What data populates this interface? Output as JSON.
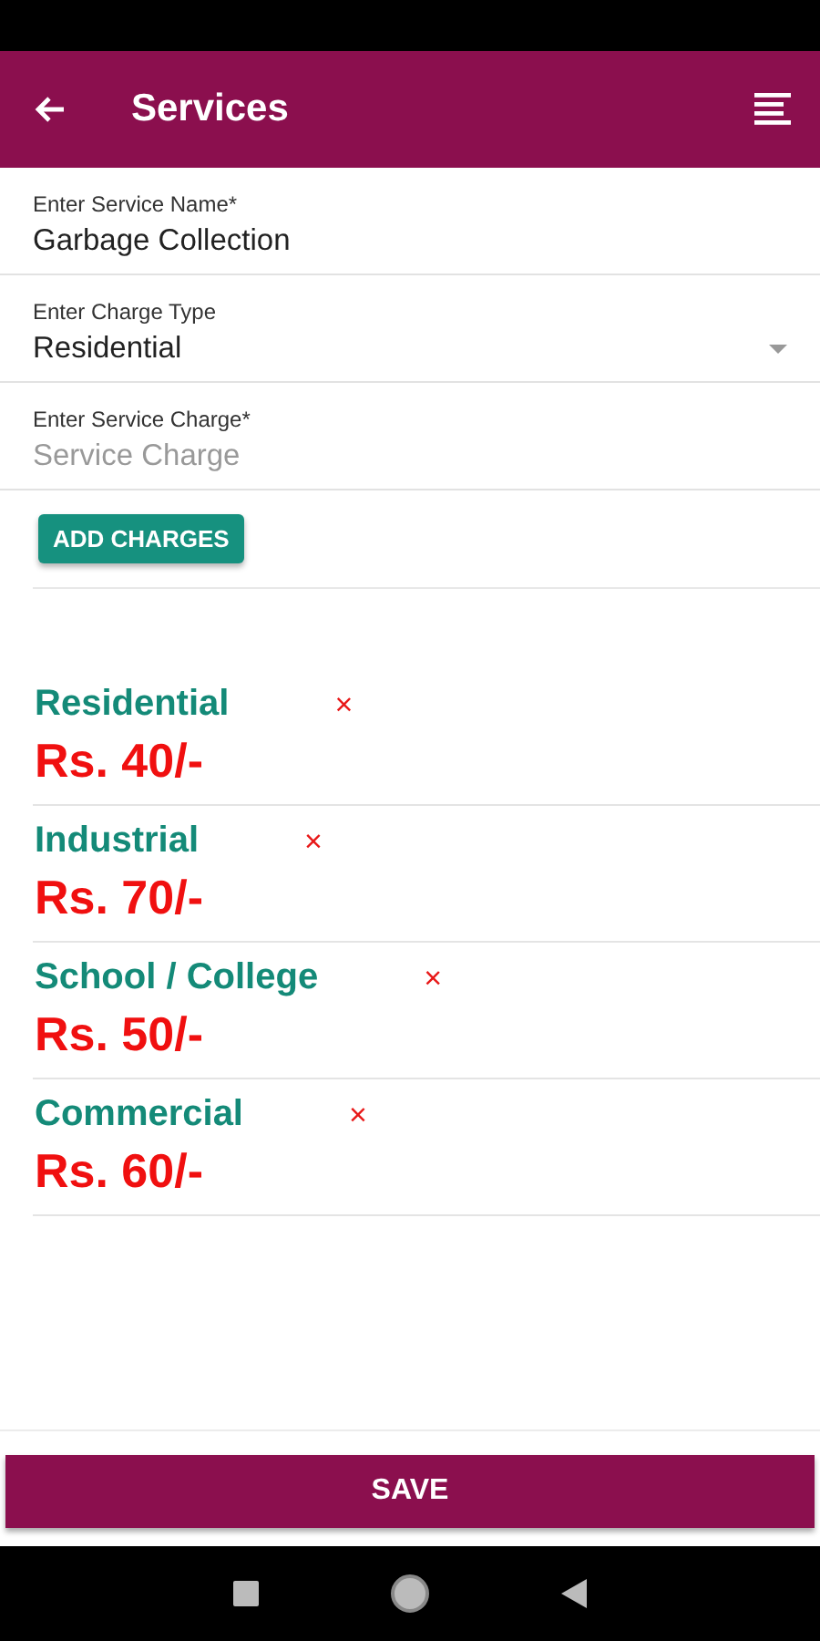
{
  "header": {
    "title": "Services"
  },
  "fields": [
    {
      "kind": "text",
      "label": "Enter Service Name*",
      "value": "Garbage Collection"
    },
    {
      "kind": "select",
      "label": "Enter Charge Type",
      "value": "Residential"
    },
    {
      "kind": "text",
      "label": "Enter Service Charge*",
      "placeholder": "Service Charge"
    }
  ],
  "add_button": "ADD CHARGES",
  "charges": [
    {
      "name": "Residential",
      "amount": "Rs. 40/-",
      "remove": "×"
    },
    {
      "name": "Industrial",
      "amount": "Rs. 70/-",
      "remove": "×"
    },
    {
      "name": "School / College",
      "amount": "Rs. 50/-",
      "remove": "×"
    },
    {
      "name": "Commercial",
      "amount": "Rs. 60/-",
      "remove": "×"
    }
  ],
  "save_button": "SAVE"
}
